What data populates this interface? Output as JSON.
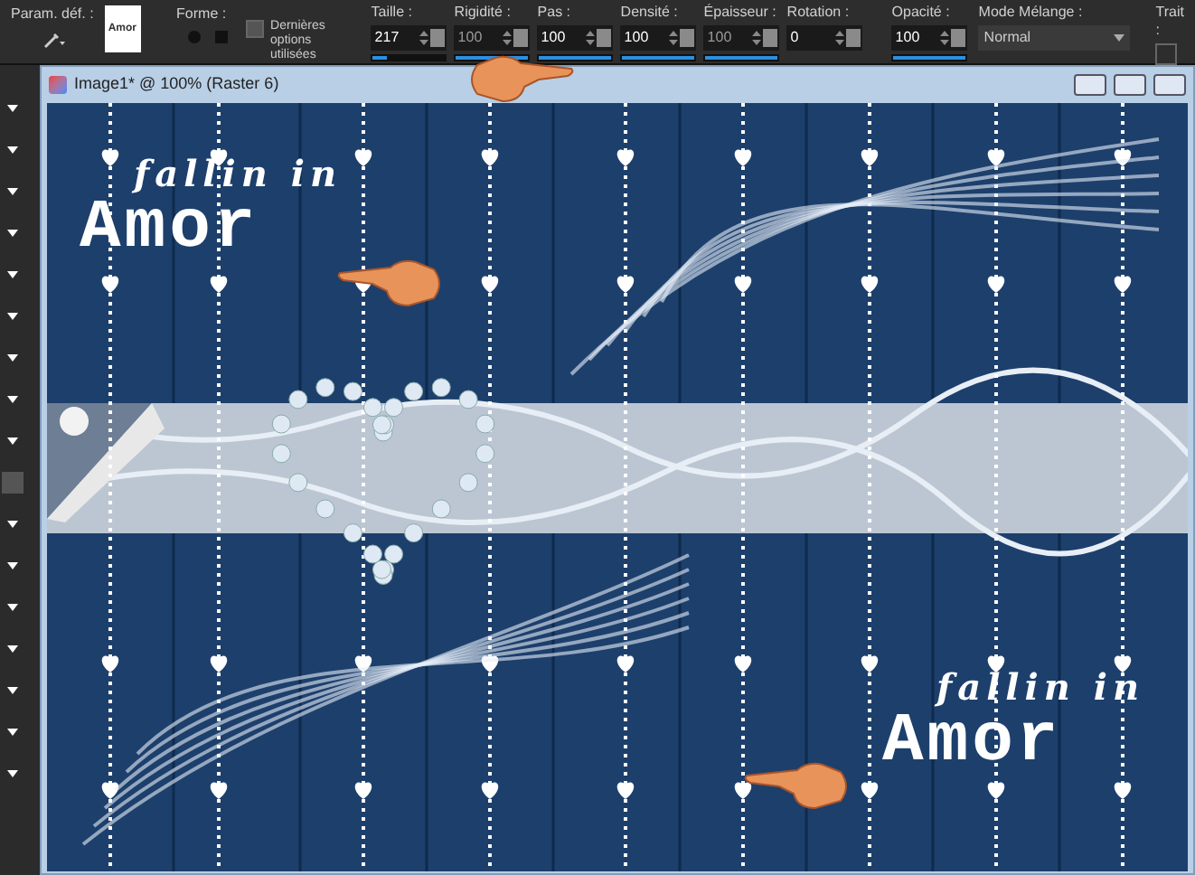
{
  "toolbar": {
    "preset_label": "Param. déf. :",
    "shape_label": "Forme :",
    "shape_preview": "Amor",
    "last_options": {
      "label": "Dernières options utilisées",
      "checked": false
    },
    "fields": [
      {
        "label": "Taille :",
        "value": "217",
        "disabled": false,
        "level": 0.2
      },
      {
        "label": "Rigidité :",
        "value": "100",
        "disabled": true,
        "level": 1
      },
      {
        "label": "Pas :",
        "value": "100",
        "disabled": false,
        "level": 1
      },
      {
        "label": "Densité :",
        "value": "100",
        "disabled": false,
        "level": 1
      },
      {
        "label": "Épaisseur :",
        "value": "100",
        "disabled": true,
        "level": 1
      },
      {
        "label": "Rotation :",
        "value": "0",
        "disabled": false
      }
    ],
    "opacity": {
      "label": "Opacité :",
      "value": "100",
      "disabled": false,
      "level": 1
    },
    "blend": {
      "label": "Mode Mélange :",
      "value": "Normal"
    },
    "stroke": {
      "label": "Trait :",
      "disabled": true
    }
  },
  "window": {
    "title": "Image1* @ 100% (Raster 6)"
  },
  "canvas": {
    "top_text": {
      "line1": "fallin in",
      "line2": "Amor"
    },
    "bottom_text": {
      "line1": "fallin in",
      "line2": "Amor"
    }
  }
}
